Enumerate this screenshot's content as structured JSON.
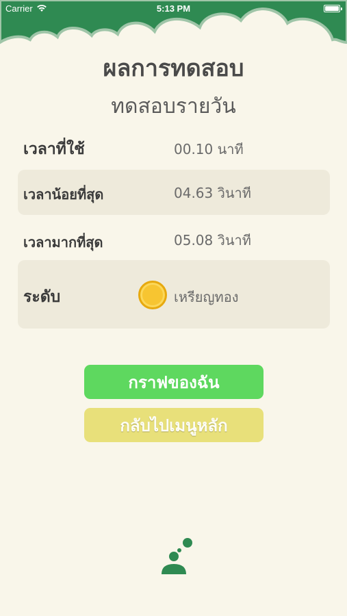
{
  "status_bar": {
    "carrier": "Carrier",
    "time": "5:13 PM",
    "icons": [
      "wifi-icon",
      "battery-icon"
    ]
  },
  "header": {
    "title": "ผลการทดสอบ",
    "subtitle": "ทดสอบรายวัน"
  },
  "results": {
    "time_used": {
      "label": "เวลาที่ใช้",
      "value": "00.10 นาที"
    },
    "min_time": {
      "label": "เวลาน้อยที่สุด",
      "value": "04.63 วินาที"
    },
    "max_time": {
      "label": "เวลามากที่สุด",
      "value": "05.08 วินาที"
    },
    "level": {
      "label": "ระดับ",
      "value": "เหรียญทอง",
      "icon": "gold-medal-icon"
    }
  },
  "buttons": {
    "graph": "กราฟของฉัน",
    "back_to_menu": "กลับไปเมนูหลัก"
  },
  "colors": {
    "header_green": "#2f8a52",
    "background": "#f9f6ea",
    "row_shade": "#eeeadb",
    "graph_button": "#5ed85f",
    "back_button": "#e8e07a",
    "medal_gold": "#f7c531"
  }
}
